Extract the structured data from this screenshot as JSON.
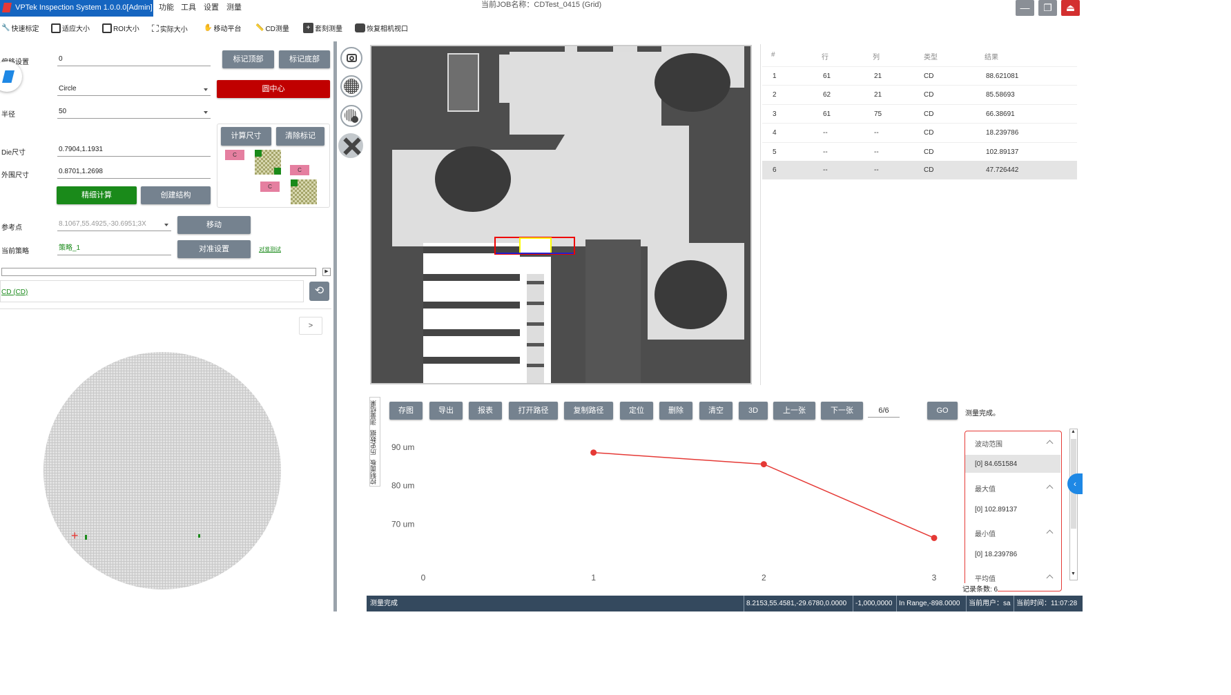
{
  "app": {
    "title": "VPTek Inspection System 1.0.0.0[Admin]",
    "job_title": "当前JOB名称：CDTest_0415 (Grid)",
    "menu": [
      "功能",
      "工具",
      "设置",
      "测量"
    ]
  },
  "toolbar": [
    "快速标定",
    "适应大小",
    "ROI大小",
    "实际大小",
    "移动平台",
    "CD测量",
    "套刻测量",
    "恢复相机视口"
  ],
  "left": {
    "offset_label": "偏移设置",
    "offset_value": "0",
    "mark_top": "标记顶部",
    "mark_bottom": "标记底部",
    "shape_value": "Circle",
    "circle_center": "圆中心",
    "radius_label": "半径",
    "radius_value": "50",
    "calc_size": "计算尺寸",
    "clear_marks": "清除标记",
    "die_label": "Die尺寸",
    "die_value": "0.7904,1.1931",
    "outer_label": "外围尺寸",
    "outer_value": "0.8701,1.2698",
    "fine_calc": "精细计算",
    "create_struct": "创建结构",
    "ref_label": "参考点",
    "ref_value": "8.1067,55.4925,-30.6951;3X",
    "move": "移动",
    "strategy_label": "当前策略",
    "strategy_value": "策略_1",
    "align_settings": "对准设置",
    "align_test": "对准测试",
    "cd_link": "CD (CD)",
    "expand": ">",
    "die_marker": "C"
  },
  "table": {
    "headers": [
      "#",
      "行",
      "列",
      "类型",
      "结果"
    ],
    "rows": [
      [
        "1",
        "61",
        "21",
        "CD",
        "88.621081"
      ],
      [
        "2",
        "62",
        "21",
        "CD",
        "85.58693"
      ],
      [
        "3",
        "61",
        "75",
        "CD",
        "66.38691"
      ],
      [
        "4",
        "--",
        "--",
        "CD",
        "18.239786"
      ],
      [
        "5",
        "--",
        "--",
        "CD",
        "102.89137"
      ],
      [
        "6",
        "--",
        "--",
        "CD",
        "47.726442"
      ]
    ]
  },
  "side_tabs": [
    "测量结果",
    "历史数据",
    "控制面板"
  ],
  "actions": [
    "存图",
    "导出",
    "报表",
    "打开路径",
    "复制路径",
    "定位",
    "删除",
    "清空",
    "3D",
    "上一张",
    "下一张"
  ],
  "page": "6/6",
  "go": "GO",
  "measure_status": "测量完成。",
  "chart_data": {
    "type": "line",
    "x": [
      1,
      2,
      3
    ],
    "values": [
      88.621081,
      85.58693,
      66.38691
    ],
    "x_ticks": [
      "0",
      "1",
      "2",
      "3"
    ],
    "y_ticks": [
      "90 um",
      "80 um",
      "70 um"
    ],
    "xlim": [
      0,
      3
    ],
    "ylim": [
      61.8,
      92.7
    ],
    "grid": false,
    "color": "#e53935"
  },
  "stats": {
    "range_label": "波动范围",
    "range_value": "[0]    84.651584",
    "max_label": "最大值",
    "max_value": "[0]    102.89137",
    "min_label": "最小值",
    "min_value": "[0]    18.239786",
    "avg_label": "平均值",
    "record_count": "记录条数: 6"
  },
  "status": {
    "left": "测量完成",
    "coords": "8.2153,55.4581,-29.6780,0.0000",
    "pos": "-1,000,0000",
    "range": "In Range,-898.0000",
    "user": "当前用户：sa",
    "time": "当前时间：11:07:28"
  }
}
